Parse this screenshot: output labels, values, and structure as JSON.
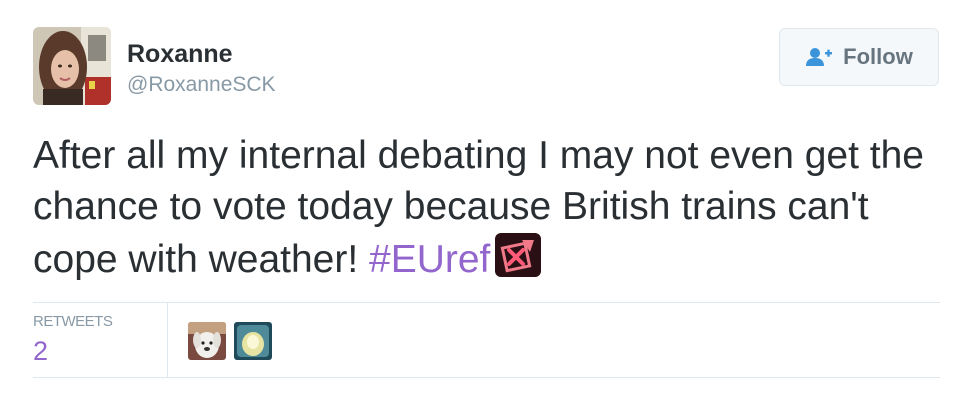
{
  "author": {
    "name": "Roxanne",
    "handle": "@RoxanneSCK",
    "avatar_icon": "profile-photo"
  },
  "follow_button": {
    "label": "Follow",
    "icon": "add-user-icon",
    "color": "#3b94d9"
  },
  "tweet": {
    "text": "After all my internal debating I may not even get the chance to vote today because British trains can't cope with weather! ",
    "hashtag": "#EUref",
    "hashtag_color": "#9266cc",
    "emoji_icon": "ballot-box-with-x-icon"
  },
  "stats": {
    "retweets_label": "RETWEETS",
    "retweets_count": "2",
    "retweeter_avatars": [
      "retweeter-avatar-dog",
      "retweeter-avatar-light"
    ]
  }
}
